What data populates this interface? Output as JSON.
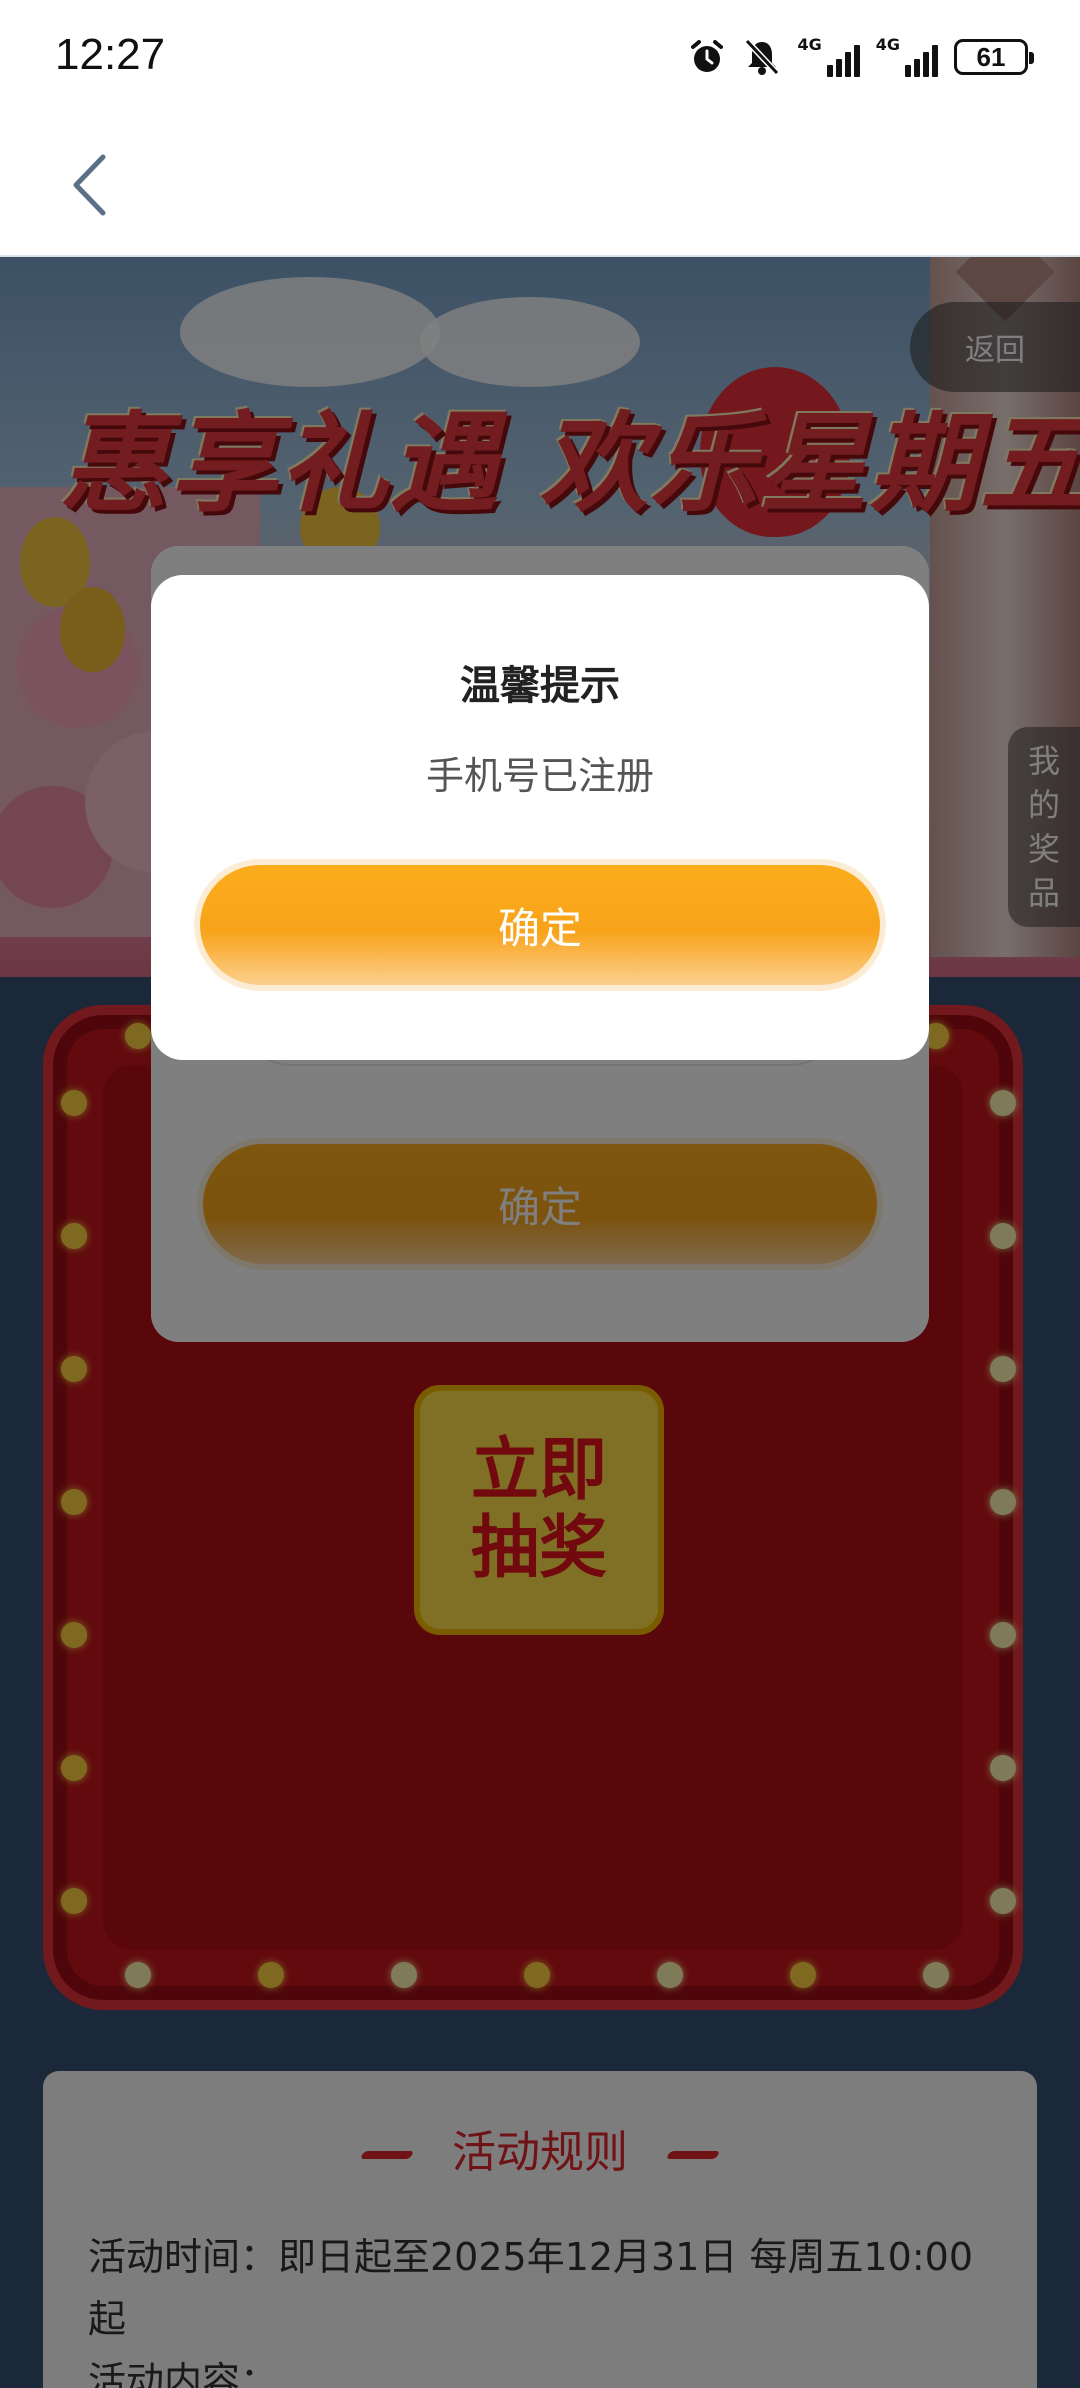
{
  "status_bar": {
    "time": "12:27",
    "network_1": "4G",
    "network_2": "4G",
    "battery": "61",
    "icons": [
      "alarm-icon",
      "mute-icon",
      "signal-icon",
      "signal-icon",
      "battery-icon"
    ]
  },
  "nav": {
    "back_icon": "chevron-left-icon"
  },
  "hero": {
    "title": "惠享礼遇 欢乐星期五",
    "return_label": "返回",
    "my_prizes_chars": [
      "我",
      "的",
      "奖",
      "品"
    ]
  },
  "lottery": {
    "draw_line_1": "立即",
    "draw_line_2": "抽奖"
  },
  "rules": {
    "title": "活动规则",
    "time_text": "活动时间：即日起至2025年12月31日 每周五10:00起",
    "content_label": "活动内容："
  },
  "form_dialog": {
    "confirm_label": "确定"
  },
  "alert": {
    "title": "温馨提示",
    "message": "手机号已注册",
    "confirm_label": "确定"
  },
  "colors": {
    "accent_orange": "#F8A418",
    "title_red": "#E63A40",
    "page_bg": "#365074"
  }
}
